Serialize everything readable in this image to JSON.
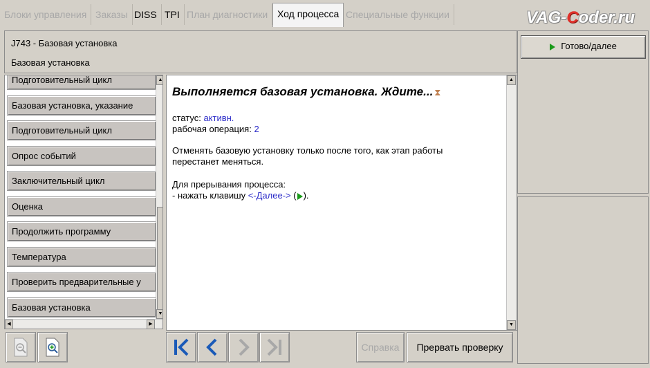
{
  "tabs": [
    {
      "label": "Блоки управления",
      "state": "disabled"
    },
    {
      "label": "Заказы",
      "state": "disabled"
    },
    {
      "label": "DISS",
      "state": "enabled"
    },
    {
      "label": "TPI",
      "state": "enabled"
    },
    {
      "label": "План диагностики",
      "state": "disabled"
    },
    {
      "label": "Ход процесса",
      "state": "active"
    },
    {
      "label": "Специальные функции",
      "state": "disabled"
    }
  ],
  "brand": {
    "pre": "VAG-",
    "c": "C",
    "post": "oder.ru"
  },
  "header": {
    "line1": "J743 - Базовая установка",
    "line2": "Базовая установка"
  },
  "right_panel": {
    "go_button": "Готово/далее",
    "go_icon": "play-triangle-icon"
  },
  "steps": [
    "Подготовительный цикл",
    "Базовая установка, указание",
    "Подготовительный цикл",
    "Опрос событий",
    "Заключительный цикл",
    "Оценка",
    "Продолжить программу",
    "Температура",
    "Проверить предварительные у",
    "Базовая установка"
  ],
  "content": {
    "title": "Выполняется базовая установка. Ждите...",
    "hourglass": "⧗",
    "status_label": "статус: ",
    "status_value": "активн.",
    "operation_label": "рабочая операция: ",
    "operation_value": "2",
    "note_line1": "Отменять базовую установку только после того, как этап работы",
    "note_line2": "перестанет меняться.",
    "abort_line1": "Для прерывания процесса:",
    "abort_prefix": "- нажать клавишу ",
    "abort_key": "<-Далее->",
    "abort_open": " (",
    "abort_close": ")."
  },
  "toolbar": {
    "help": "Справка",
    "abort": "Прервать проверку"
  },
  "colors": {
    "accent_green": "#1a9a1a",
    "link_blue": "#2a2ac8",
    "nav_blue": "#1a5ab8"
  }
}
